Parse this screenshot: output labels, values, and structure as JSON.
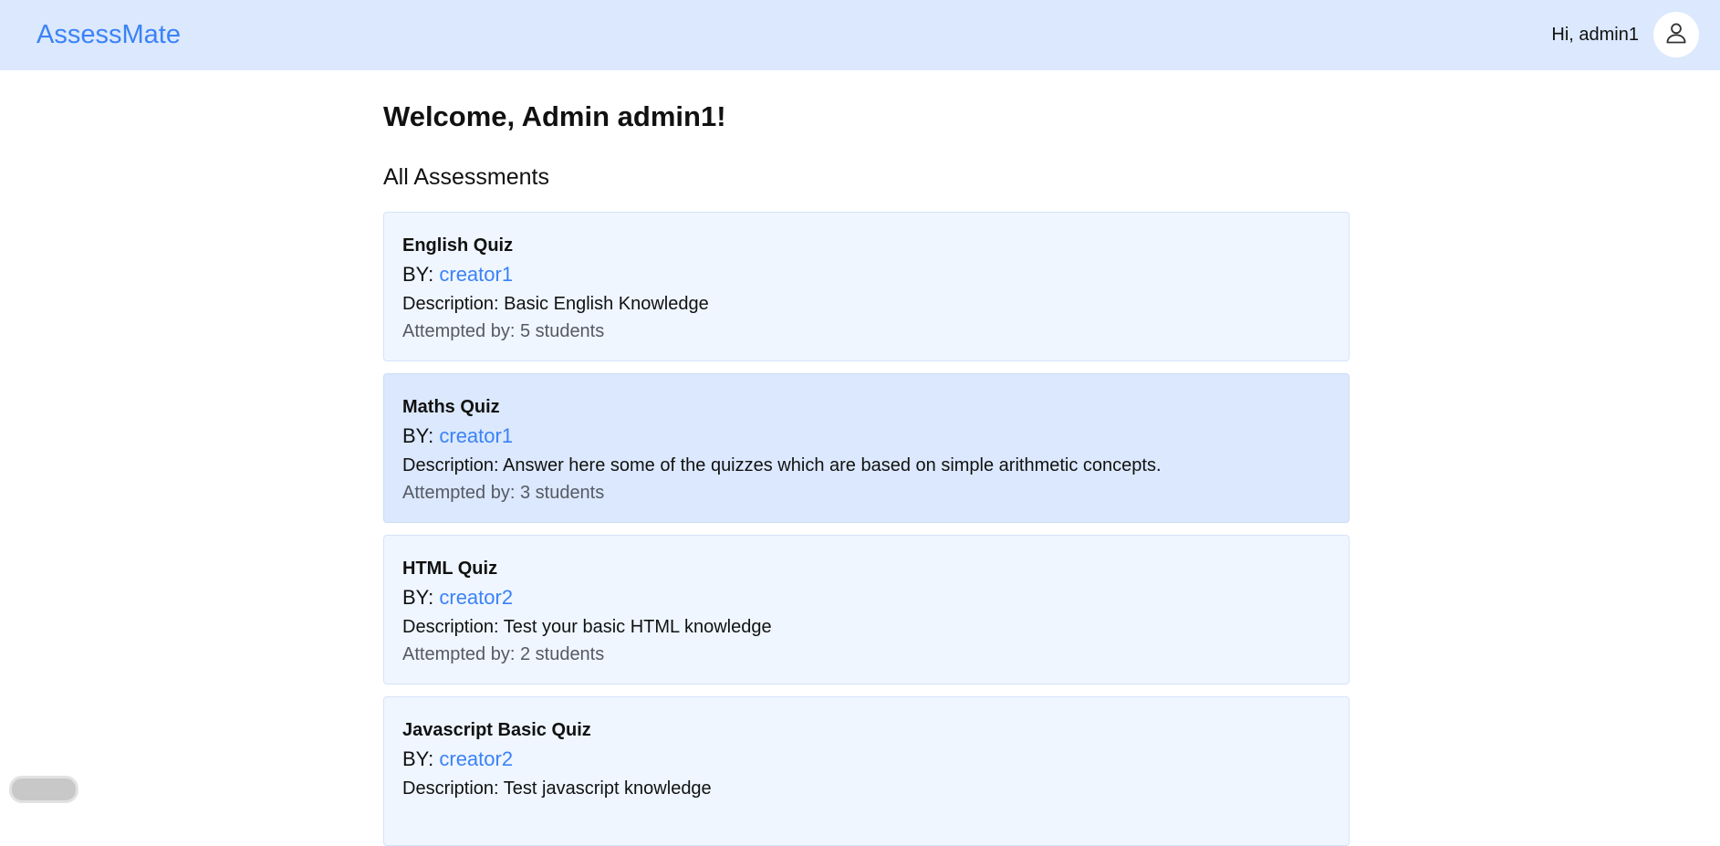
{
  "header": {
    "brand": "AssessMate",
    "greeting": "Hi, admin1",
    "avatar_icon": "user-icon"
  },
  "main": {
    "welcome": "Welcome, Admin admin1!",
    "section_title": "All Assessments",
    "by_label": "BY:",
    "assessments": [
      {
        "title": "English Quiz",
        "creator": "creator1",
        "description": "Description: Basic English Knowledge",
        "attempts": "Attempted by: 5 students"
      },
      {
        "title": "Maths Quiz",
        "creator": "creator1",
        "description": "Description: Answer here some of the quizzes which are based on simple arithmetic concepts.",
        "attempts": "Attempted by: 3 students"
      },
      {
        "title": "HTML Quiz",
        "creator": "creator2",
        "description": "Description: Test your basic HTML knowledge",
        "attempts": "Attempted by: 2 students"
      },
      {
        "title": "Javascript Basic Quiz",
        "creator": "creator2",
        "description": "Description: Test javascript knowledge",
        "attempts": ""
      }
    ]
  },
  "colors": {
    "header_bg": "#dbe8fd",
    "brand": "#3b82f6",
    "card_bg": "#eff6ff",
    "card_hover_bg": "#dbe8fd",
    "link": "#3b82f6",
    "muted_text": "#555a63"
  }
}
